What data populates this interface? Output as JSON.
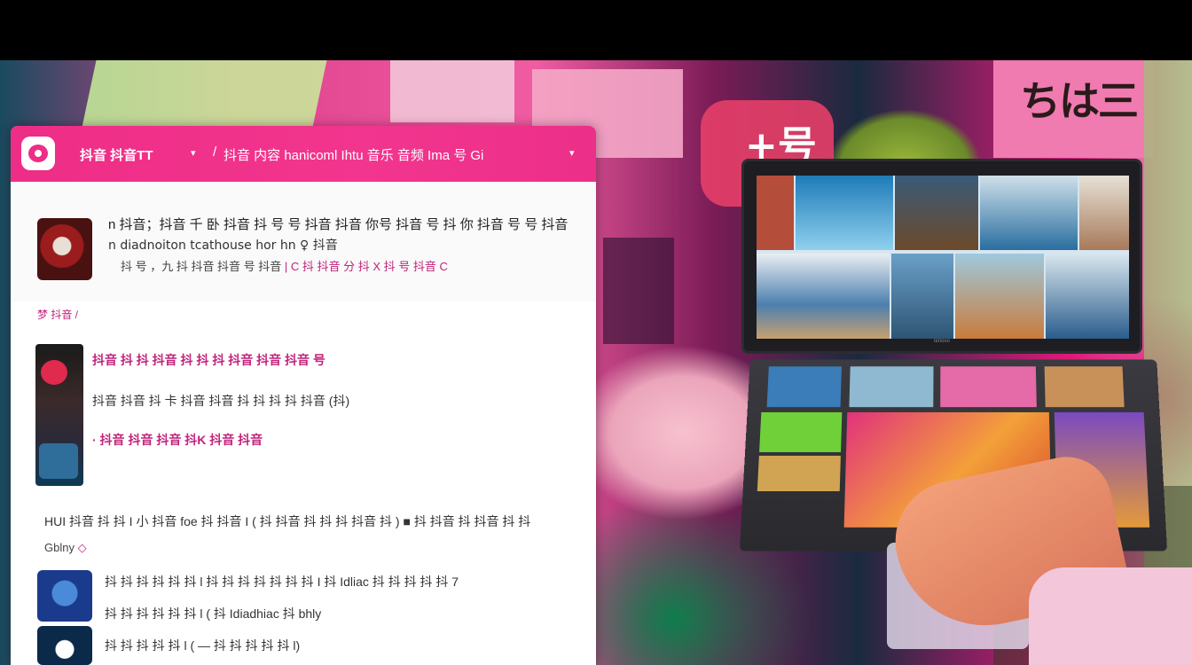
{
  "header": {
    "title": "抖音 抖音TT",
    "caret": "▾",
    "slash": "/",
    "breadcrumb": "抖音 内容 hanicoml Ihtu 音乐 音频 Ima 号 Gi",
    "caret2": "▾"
  },
  "post": {
    "line1": "n 抖音；抖音 千 卧 抖音 抖 号 号 抖音 抖音 你号 抖音 号 抖 你 抖音 号 号 抖音",
    "line2": "n diadnoiton    tcathouse hor  hn  ♀ 抖音",
    "line3_a": "抖 号 ，九 抖 抖音 抖音 号 抖音 ",
    "line3_sep": "|",
    "line3_b": " C 抖 抖音 分 抖 X 抖 号 抖音 C"
  },
  "section_label": "梦 抖音 /",
  "list": {
    "item1": "抖音 抖 抖 抖音 抖 抖 抖 抖音 抖音 抖音 号",
    "item2": "抖音 抖音 抖 卡 抖音 抖音 抖 抖 抖 抖 抖音 (抖)",
    "item3": "· 抖音 抖音 抖音 抖K 抖音 抖音"
  },
  "paragraph": "HUI 抖音 抖 抖 I 小 抖音 foe 抖 抖音 I ( 抖 抖音 抖 抖 抖 抖音 抖 ) ■ 抖 抖音 抖 抖音 抖 抖",
  "sub_label": "Gblny",
  "sub_label_dot": "◇",
  "rows": {
    "row1": "抖 抖 抖 抖 抖 抖 l 抖 抖 抖 抖 抖 抖 抖 I 抖 Idliac 抖 抖 抖 抖 抖 7",
    "row2": "抖 抖 抖 抖 抖 抖 l ( 抖 Idiadhiac 抖 bhly",
    "row3": "抖 抖 抖 抖 抖 l ( — 抖 抖 抖 抖 抖 l)"
  },
  "laptop": {
    "brand": "lenovo"
  },
  "collage": {
    "text1": "ちは三",
    "text2": "+号"
  },
  "colors": {
    "accent": "#ee2d86",
    "accent_text": "#c1237a"
  },
  "icons": [
    "app-logo-icon"
  ]
}
